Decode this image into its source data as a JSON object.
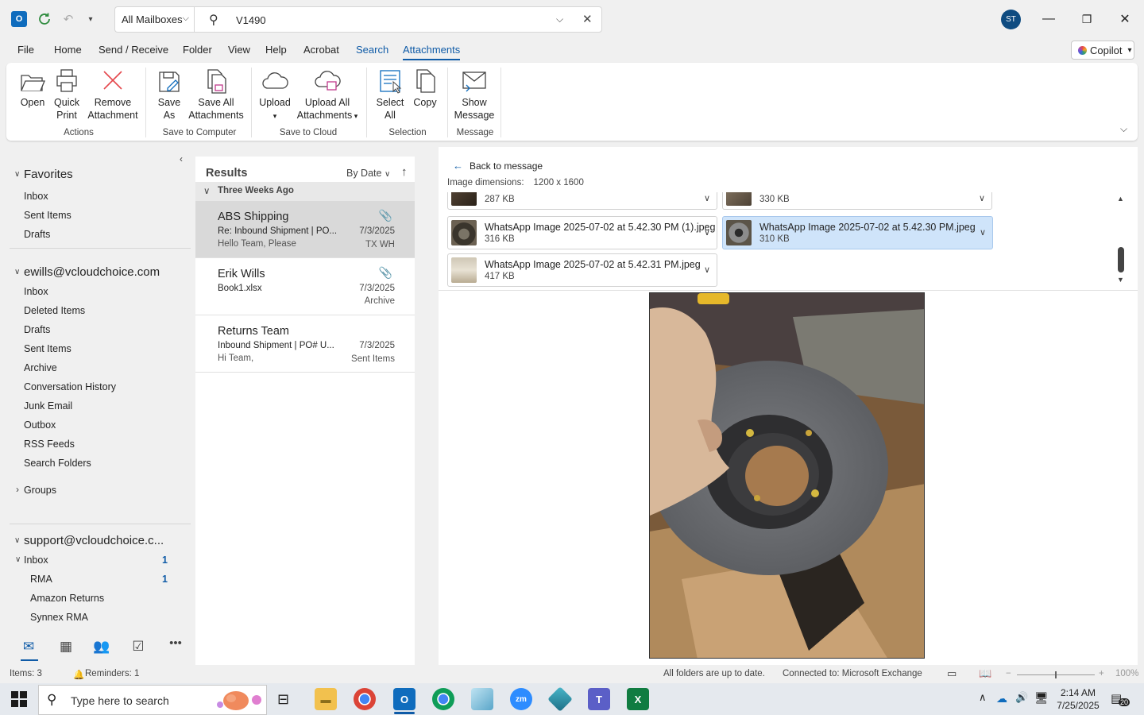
{
  "titlebar": {
    "mailbox_scope": "All Mailboxes",
    "search_value": "V1490",
    "avatar_initials": "ST"
  },
  "menu": {
    "tabs": [
      "File",
      "Home",
      "Send / Receive",
      "Folder",
      "View",
      "Help",
      "Acrobat",
      "Search",
      "Attachments"
    ],
    "active_tab": "Attachments",
    "copilot_label": "Copilot"
  },
  "ribbon": {
    "buttons": {
      "open": "Open",
      "quick_print_1": "Quick",
      "quick_print_2": "Print",
      "remove_1": "Remove",
      "remove_2": "Attachment",
      "save_as_1": "Save",
      "save_as_2": "As",
      "save_all_1": "Save All",
      "save_all_2": "Attachments",
      "upload": "Upload",
      "upload_all_1": "Upload All",
      "upload_all_2": "Attachments",
      "select_all_1": "Select",
      "select_all_2": "All",
      "copy": "Copy",
      "show_msg_1": "Show",
      "show_msg_2": "Message"
    },
    "groups": {
      "actions": "Actions",
      "save_to_computer": "Save to Computer",
      "save_to_cloud": "Save to Cloud",
      "selection": "Selection",
      "message": "Message"
    }
  },
  "folders": {
    "favorites_header": "Favorites",
    "favorites": [
      "Inbox",
      "Sent Items",
      "Drafts"
    ],
    "account1_header": "ewills@vcloudchoice.com",
    "account1": [
      "Inbox",
      "Deleted Items",
      "Drafts",
      "Sent Items",
      "Archive",
      "Conversation History",
      "Junk Email",
      "Outbox",
      "RSS Feeds",
      "Search Folders"
    ],
    "groups_header": "Groups",
    "account2_header": "support@vcloudchoice.c...",
    "account2": [
      {
        "name": "Inbox",
        "count": "1"
      },
      {
        "name": "RMA",
        "count": "1"
      },
      {
        "name": "Amazon Returns",
        "count": ""
      },
      {
        "name": "Synnex RMA",
        "count": ""
      }
    ]
  },
  "message_list": {
    "results_label": "Results",
    "sort_label": "By Date",
    "group_label": "Three Weeks Ago",
    "messages": [
      {
        "from": "ABS Shipping",
        "subject": "Re: Inbound Shipment | PO...",
        "preview": "Hello Team,  Please",
        "date": "7/3/2025",
        "folder": "TX WH"
      },
      {
        "from": "Erik Wills",
        "subject": "Book1.xlsx",
        "preview": "",
        "date": "7/3/2025",
        "folder": "Archive"
      },
      {
        "from": "Returns Team",
        "subject": "Inbound Shipment | PO# U...",
        "preview": "Hi Team,",
        "date": "7/3/2025",
        "folder": "Sent Items"
      }
    ]
  },
  "reading": {
    "back_label": "Back to message",
    "dims_label": "Image dimensions:",
    "dims_value": "1200 x 1600",
    "attachments": [
      {
        "name": "",
        "size": "287 KB"
      },
      {
        "name": "",
        "size": "330 KB"
      },
      {
        "name": "WhatsApp Image 2025-07-02 at 5.42.30 PM (1).jpeg",
        "size": "316 KB"
      },
      {
        "name": "WhatsApp Image 2025-07-02 at 5.42.30 PM.jpeg",
        "size": "310 KB"
      },
      {
        "name": "WhatsApp Image 2025-07-02 at 5.42.31 PM.jpeg",
        "size": "417 KB"
      }
    ]
  },
  "status": {
    "items": "Items: 3",
    "reminders": "Reminders: 1",
    "sync": "All folders are up to date.",
    "connection": "Connected to: Microsoft Exchange",
    "zoom": "100%"
  },
  "taskbar": {
    "search_placeholder": "Type here to search",
    "time": "2:14 AM",
    "date": "7/25/2025",
    "notification_count": "20"
  },
  "colors": {
    "accent": "#0f5ba7",
    "avatar": "#0f4c81",
    "selected_attachment": "#cfe4fa"
  }
}
